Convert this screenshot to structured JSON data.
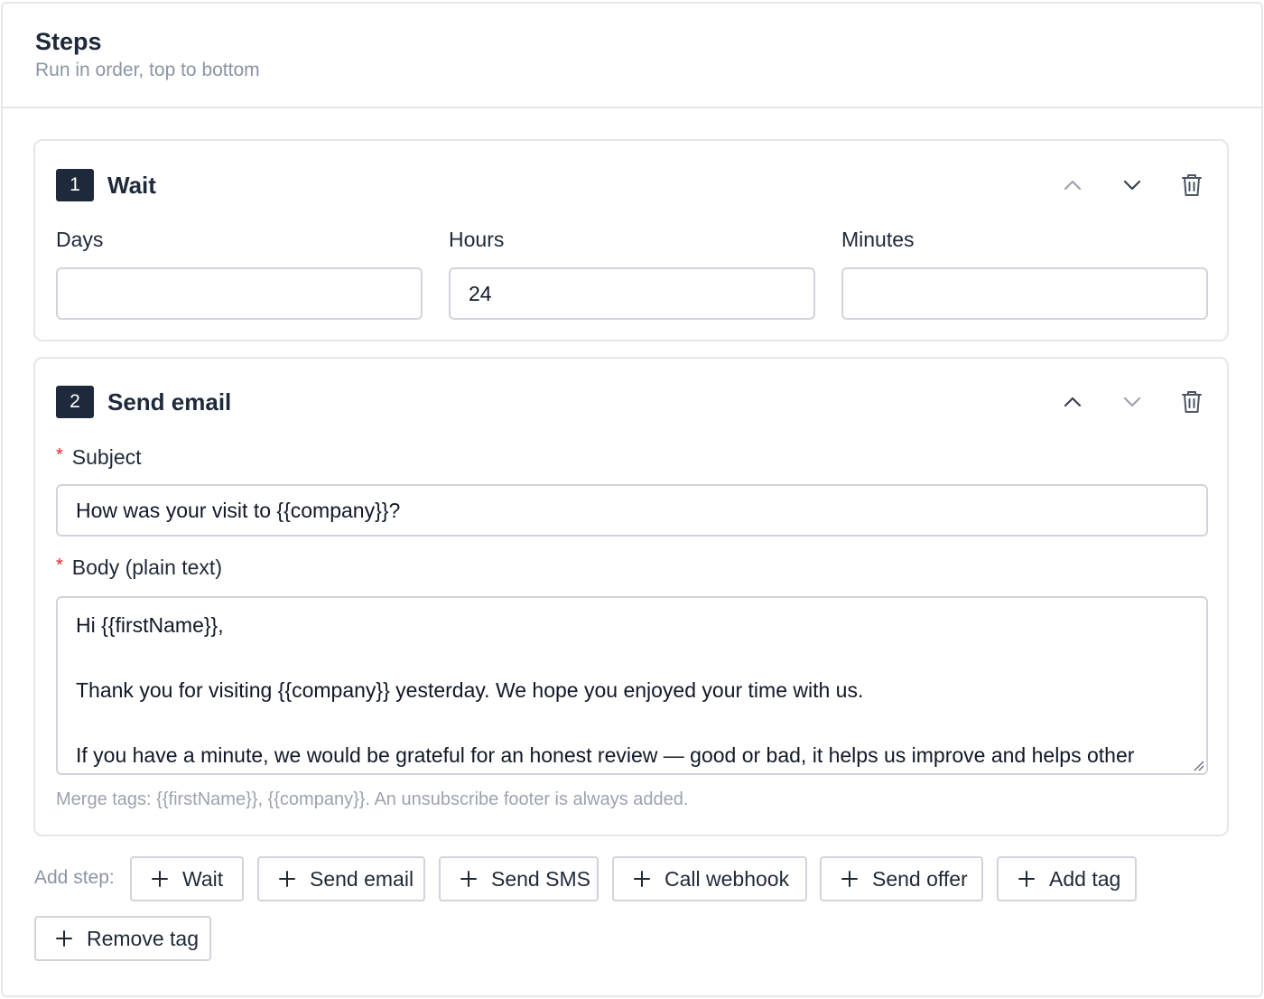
{
  "panel": {
    "title": "Steps",
    "subtitle": "Run in order, top to bottom"
  },
  "steps": [
    {
      "number": "1",
      "title": "Wait",
      "fields": {
        "days": {
          "label": "Days",
          "value": ""
        },
        "hours": {
          "label": "Hours",
          "value": "24"
        },
        "minutes": {
          "label": "Minutes",
          "value": ""
        }
      },
      "actions": {
        "move_up": "chevron-up-icon",
        "move_down": "chevron-down-icon",
        "delete": "trash-icon"
      }
    },
    {
      "number": "2",
      "title": "Send email",
      "subject": {
        "label": "Subject",
        "required_mark": "*",
        "value": "How was your visit to {{company}}?"
      },
      "body": {
        "label": "Body (plain text)",
        "required_mark": "*",
        "lines": [
          "Hi {{firstName}},",
          "",
          "Thank you for visiting {{company}} yesterday. We hope you enjoyed your time with us.",
          "",
          "If you have a minute, we would be grateful for an honest review — good or bad, it helps us improve and helps other"
        ]
      },
      "hint": "Merge tags: {{firstName}}, {{company}}. An unsubscribe footer is always added.",
      "actions": {
        "move_up": "chevron-up-icon",
        "move_down": "chevron-down-icon",
        "delete": "trash-icon"
      }
    }
  ],
  "add_step": {
    "label": "Add step:",
    "buttons": [
      "Wait",
      "Send email",
      "Send SMS",
      "Call webhook",
      "Send offer",
      "Add tag",
      "Remove tag"
    ]
  },
  "colors": {
    "badge_bg": "#1e293b",
    "border": "#d1d5db",
    "required": "#dc2626",
    "muted_text": "#8b95a3"
  }
}
